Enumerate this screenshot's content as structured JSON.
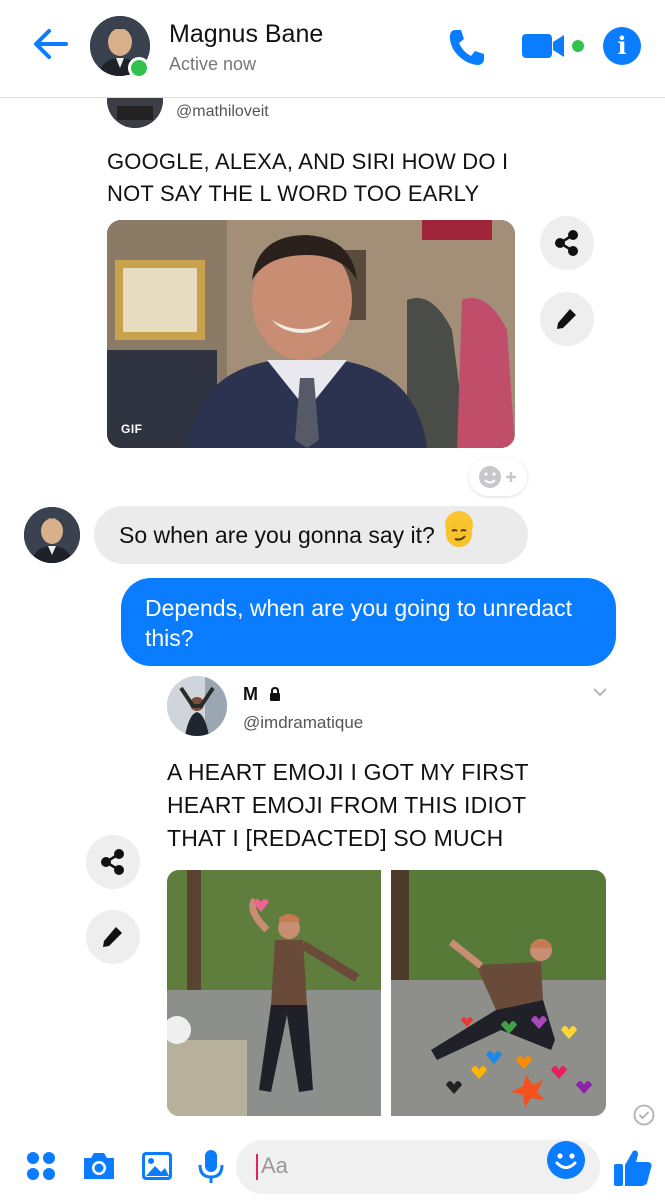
{
  "header": {
    "contact_name": "Magnus Bane",
    "status": "Active now",
    "icons": [
      "back-arrow-icon",
      "phone-icon",
      "video-camera-icon",
      "info-icon"
    ],
    "accent": "#0a7cff",
    "online_color": "#31c24d"
  },
  "tweet1": {
    "handle": "@mathiloveit",
    "text": "GOOGLE, ALEXA, AND SIRI HOW DO I NOT SAY THE L WORD TOO EARLY",
    "media_label": "GIF"
  },
  "messages": {
    "incoming": "So when are you gonna say it?",
    "incoming_emoji": "smirk-emoji",
    "outgoing": "Depends, when are you going to unredact this?",
    "bubble_in_color": "#ebebeb",
    "bubble_out_color": "#0a7cff"
  },
  "tweet2": {
    "name": "M",
    "handle": "@imdramatique",
    "text": "A HEART EMOJI I GOT MY FIRST HEART EMOJI FROM THIS IDIOT THAT I [REDACTED] SO MUCH"
  },
  "composer": {
    "placeholder": "Aa",
    "icons": [
      "apps-grid-icon",
      "camera-icon",
      "gallery-icon",
      "microphone-icon",
      "emoji-icon",
      "thumbs-up-icon"
    ]
  }
}
